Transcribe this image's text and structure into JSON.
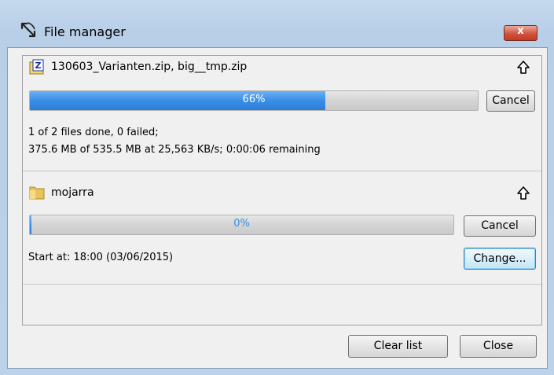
{
  "window": {
    "title": "File manager",
    "close_label": "x"
  },
  "transfers": [
    {
      "icon": "zip-file-icon",
      "name": "130603_Varianten.zip, big__tmp.zip",
      "progress": 0.66,
      "progress_label": "66%",
      "button_label": "Cancel",
      "status_line1": "1 of 2 files done, 0 failed;",
      "status_line2": "375.6 MB of 535.5 MB at 25,563 KB/s; 0:00:06 remaining"
    },
    {
      "icon": "folder-icon",
      "name": "mojarra",
      "progress": 0.0,
      "progress_label": "0%",
      "button_label": "Cancel",
      "status_line1": "Start at: 18:00 (03/06/2015)",
      "secondary_button_label": "Change..."
    }
  ],
  "footer": {
    "clear_label": "Clear list",
    "close_label": "Close"
  },
  "colors": {
    "progress_blue": "#3a8de6",
    "progress_text_on_fill": "#ffffff",
    "progress_text_empty": "#3a8de6"
  }
}
